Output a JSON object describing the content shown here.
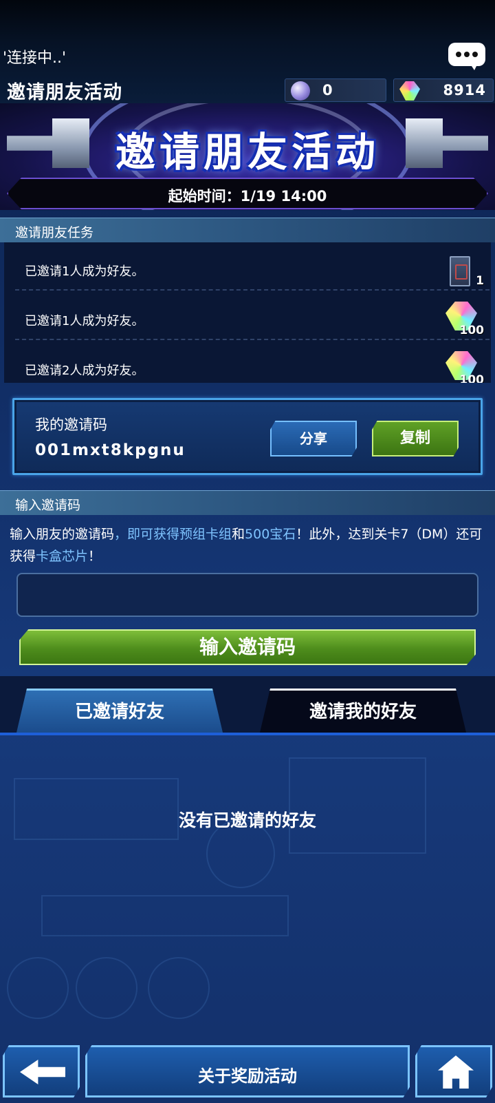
{
  "status": {
    "connection": "'连接中..'"
  },
  "header": {
    "title": "邀请朋友活动",
    "currencies": [
      {
        "icon": "orb-icon",
        "value": "0"
      },
      {
        "icon": "gem-icon",
        "value": "8914"
      }
    ]
  },
  "banner": {
    "title": "邀请朋友活动",
    "start_time": "起始时间：1/19 14:00"
  },
  "missions": {
    "heading": "邀请朋友任务",
    "items": [
      {
        "text": "已邀请1人成为好友。",
        "reward_icon": "card-pack-icon",
        "quantity": "1"
      },
      {
        "text": "已邀请1人成为好友。",
        "reward_icon": "gem-icon",
        "quantity": "100"
      },
      {
        "text": "已邀请2人成为好友。",
        "reward_icon": "gem-icon",
        "quantity": "100"
      }
    ]
  },
  "invite_code": {
    "label": "我的邀请码",
    "value": "001mxt8kpgnu",
    "share_label": "分享",
    "copy_label": "复制"
  },
  "enter_code": {
    "heading": "输入邀请码",
    "desc_1": "输入朋友的邀请码",
    "desc_2": "，即可获得预组卡组",
    "desc_3": "和",
    "desc_4": "500宝石",
    "desc_5": "！此外，达到关卡7（DM）还可获得",
    "desc_6": "卡盒芯片",
    "desc_7": "！",
    "input_value": "",
    "button_label": "输入邀请码"
  },
  "tabs": [
    {
      "label": "已邀请好友"
    },
    {
      "label": "邀请我的好友"
    }
  ],
  "empty_message": "没有已邀请的好友",
  "footer": {
    "about_label": "关于奖励活动"
  },
  "colors": {
    "highlight": "#7fc4ff",
    "accent_green": "#5fa126",
    "accent_blue": "#2b6bb6"
  }
}
